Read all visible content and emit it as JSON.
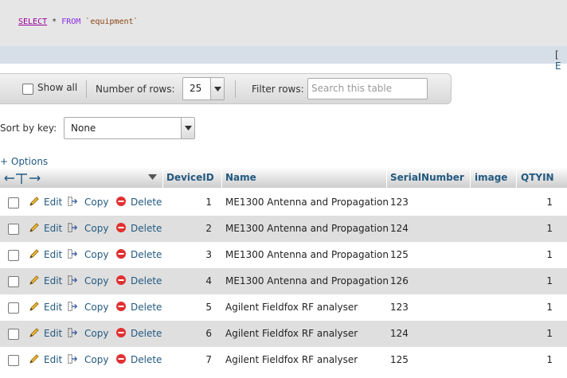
{
  "sql": {
    "select": "SELECT",
    "star": " * ",
    "from": "FROM",
    "table": " `equipment`"
  },
  "strip": {
    "bracket": "[",
    "link": "E"
  },
  "nav": {
    "show_all": "Show all",
    "rows_label": "Number of rows:",
    "rows_value": "25",
    "filter_label": "Filter rows:",
    "search_placeholder": "Search this table"
  },
  "sort": {
    "label": "Sort by key:",
    "value": "None"
  },
  "options": "+ Options",
  "columns": [
    "DeviceID",
    "Name",
    "SerialNumber",
    "image",
    "QTYIN"
  ],
  "actions": {
    "edit": "Edit",
    "copy": "Copy",
    "delete": "Delete"
  },
  "rows": [
    {
      "id": "1",
      "name": "ME1300 Antenna and Propagation",
      "serial": "123",
      "image": "",
      "qty": "1"
    },
    {
      "id": "2",
      "name": "ME1300 Antenna and Propagation",
      "serial": "124",
      "image": "",
      "qty": "1"
    },
    {
      "id": "3",
      "name": "ME1300 Antenna and Propagation",
      "serial": "125",
      "image": "",
      "qty": "1"
    },
    {
      "id": "4",
      "name": "ME1300 Antenna and Propagation",
      "serial": "126",
      "image": "",
      "qty": "1"
    },
    {
      "id": "5",
      "name": "Agilent Fieldfox RF analyser",
      "serial": "123",
      "image": "",
      "qty": "1"
    },
    {
      "id": "6",
      "name": "Agilent Fieldfox RF analyser",
      "serial": "124",
      "image": "",
      "qty": "1"
    },
    {
      "id": "7",
      "name": "Agilent Fieldfox RF analyser",
      "serial": "125",
      "image": "",
      "qty": "1"
    }
  ]
}
